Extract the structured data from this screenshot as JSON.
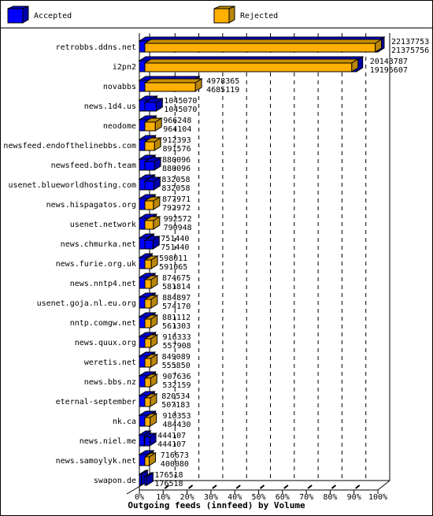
{
  "chart_data": {
    "type": "bar",
    "orientation": "horizontal",
    "style": "3d",
    "title": "Outgoing feeds (innfeed) by Volume",
    "xlabel": "",
    "ylabel": "",
    "xlim_percent": [
      0,
      100
    ],
    "x_ticks": [
      "0%",
      "10%",
      "20%",
      "30%",
      "40%",
      "50%",
      "60%",
      "70%",
      "80%",
      "90%",
      "100%"
    ],
    "grid": true,
    "legend_position": "top",
    "legend": [
      {
        "name": "Accepted",
        "color": "#0000ff"
      },
      {
        "name": "Rejected",
        "color": "#ffb000"
      }
    ],
    "categories": [
      "retrobbs.ddns.net",
      "i2pn2",
      "novabbs",
      "news.1d4.us",
      "neodome",
      "newsfeed.endofthelinebbs.com",
      "newsfeed.bofh.team",
      "usenet.blueworldhosting.com",
      "news.hispagatos.org",
      "usenet.network",
      "news.chmurka.net",
      "news.furie.org.uk",
      "news.nntp4.net",
      "usenet.goja.nl.eu.org",
      "nntp.comgw.net",
      "news.quux.org",
      "weretis.net",
      "news.bbs.nz",
      "eternal-september",
      "nk.ca",
      "news.niel.me",
      "news.samoylyk.net",
      "swapon.de"
    ],
    "series": [
      {
        "name": "Accepted",
        "values": [
          22137753,
          20143787,
          4978365,
          1045070,
          966248,
          912393,
          880096,
          832058,
          877971,
          992572,
          751440,
          598011,
          874675,
          884897,
          881112,
          916333,
          849089,
          907636,
          820534,
          910353,
          444107,
          716673,
          176518
        ]
      },
      {
        "name": "Rejected",
        "values": [
          21375756,
          19195607,
          4685119,
          1045070,
          964104,
          891576,
          880096,
          832058,
          792972,
          790948,
          751440,
          591065,
          581814,
          574170,
          561303,
          557908,
          555850,
          532159,
          507183,
          484430,
          444107,
          400080,
          176518
        ]
      }
    ],
    "max_value": 22137753
  },
  "colors": {
    "accepted_front": "#0000ff",
    "accepted_side": "#0000a8",
    "accepted_top": "#0000c8",
    "rejected_front": "#ffb000",
    "rejected_side": "#b8860b",
    "rejected_top": "#c89000"
  }
}
